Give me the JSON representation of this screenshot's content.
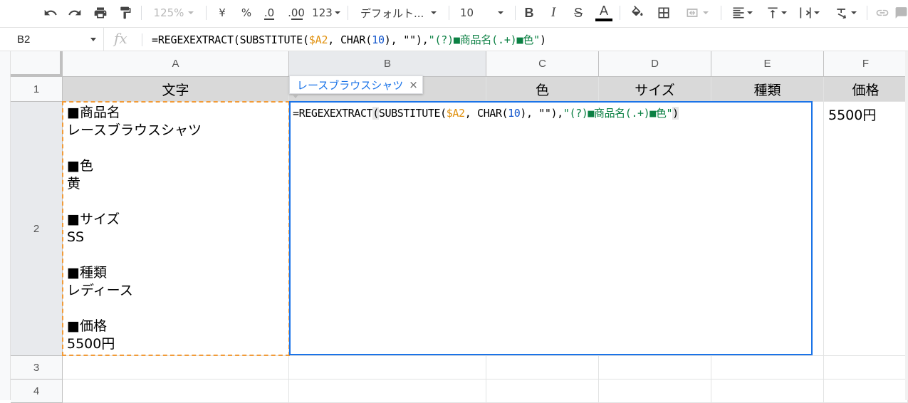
{
  "toolbar": {
    "zoom": "125%",
    "currency": "¥",
    "percent": "%",
    "dec_decrease": ".0",
    "dec_increase": ".00",
    "format_more": "123",
    "font_family": "デフォルト...",
    "font_size": "10",
    "text_color_bar": "#000000"
  },
  "formula_bar": {
    "cell_ref": "B2",
    "fx_label": "fx",
    "formula": {
      "p1": "=REGEXEXTRACT(SUBSTITUTE(",
      "ref": "$A2",
      "p2": ", CHAR(",
      "num": "10",
      "p3": "), \"\"),",
      "str": "\"(?)■商品名(.+)■色\"",
      "p4": ")"
    }
  },
  "columns": [
    "A",
    "B",
    "C",
    "D",
    "E",
    "F"
  ],
  "rows": [
    "1",
    "2",
    "3",
    "4"
  ],
  "header_row": {
    "a": "文字",
    "c": "色",
    "d": "サイズ",
    "e": "種類",
    "f": "価格"
  },
  "cell_a2": "■商品名\nレースブラウスシャツ\n\n■色\n黄\n\n■サイズ\nSS\n\n■種類\nレディース\n\n■価格\n5500円",
  "cell_f2": "5500円",
  "editor": {
    "p1": "=REGEXEXTRACT",
    "paren_open": "(",
    "p2": "SUBSTITUTE(",
    "ref": "$A2",
    "p3": ", CHAR(",
    "num": "10",
    "p4": "), \"\"),",
    "str": "\"(?)■商品名(.+)■色\"",
    "paren_close": ")"
  },
  "preview_tooltip": {
    "value": "レースブラウスシャツ",
    "close": "×"
  },
  "colors": {
    "selection": "#1a73e8",
    "copy_border": "#f29b38",
    "string": "#0b8043",
    "reference": "#e0900d",
    "number": "#1155cc"
  }
}
